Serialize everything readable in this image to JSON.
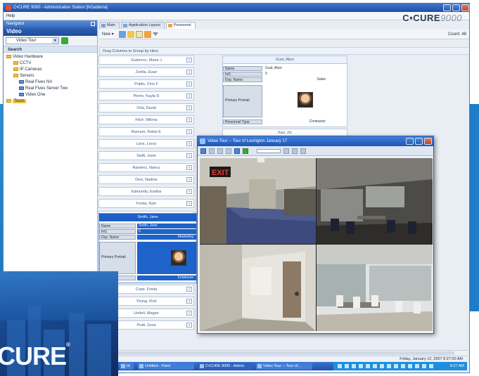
{
  "window": {
    "title": "C•CURE 9000 - Administration Station [NGalderia]",
    "menu": "Help",
    "brand": "C•CURE",
    "brand_version": "9000"
  },
  "navigator": {
    "header": "Navigator",
    "title": "Video",
    "filter_value": "Video Tour",
    "search_label": "Search",
    "tree": [
      {
        "label": "Video Hardware",
        "level": 0
      },
      {
        "label": "CCTV",
        "level": 1
      },
      {
        "label": "IP Cameras",
        "level": 1
      },
      {
        "label": "Servers",
        "level": 1
      },
      {
        "label": "Real Fives NV",
        "level": 2
      },
      {
        "label": "Real Fives Server Two",
        "level": 2
      },
      {
        "label": "Video One",
        "level": 2
      },
      {
        "label": "Tours",
        "level": 0
      }
    ]
  },
  "tabs": [
    {
      "label": "Main",
      "active": false
    },
    {
      "label": "Application Layout",
      "active": false
    },
    {
      "label": "Personnel",
      "active": true
    }
  ],
  "toolbar": {
    "new_label": "New ▾",
    "count": "Count: 48"
  },
  "grouping_hint": "Drag Columns to Group by Here",
  "personnel_cards": [
    "Gutierrez, Maria J",
    "Zorilla, Evan",
    "Public, Finn F",
    "Pierre, Kayla D",
    "Orla, David",
    "Fitch, Milena",
    "Barnum, Robin E",
    "Lans, Leroy",
    "Swift, Josie",
    "Ramirez, Nancy",
    "Devi, Nadine",
    "Edmunds, Eartha",
    "Freda, Kyle",
    "Betancourt, Raphael"
  ],
  "personnel_cards_bottom": [
    "Cope, Freda",
    "Young, Rod",
    "Undell, Megan",
    "Pratt, Zena"
  ],
  "selected_card": {
    "title": "Smith, Jane",
    "fields": [
      {
        "key": "Name",
        "value": "Smith, Jane"
      },
      {
        "key": "Int1",
        "value": "0"
      },
      {
        "key": "Dsp. Name",
        "value": "Marketing"
      }
    ],
    "portrait_label": "Primary Portrait",
    "type_key": "Type",
    "type_value": "Employee"
  },
  "open_card": {
    "title": "Gust, Alice",
    "fields": [
      {
        "key": "Name",
        "value": "Gust, Alice"
      },
      {
        "key": "Int1",
        "value": "0"
      },
      {
        "key": "Dsp. Name",
        "value": "Sales"
      }
    ],
    "portrait_label": "Primary Portrait",
    "type_key": "Personnel Type",
    "type_value": "Contractor"
  },
  "next_card": "Kao, Jin",
  "video_window": {
    "title": "Video Tour -- Tour of Lexington January 17"
  },
  "status": {
    "datetime": "Friday, January 12, 2007 8:27:00 AM"
  },
  "taskbar": {
    "items": [
      "Id",
      "Untitled - Paint",
      "C•CURE 9000 - Admin",
      "Video Tour -- Tour of..."
    ],
    "clock": "8:27 AM"
  },
  "splash_logo": "CURE"
}
